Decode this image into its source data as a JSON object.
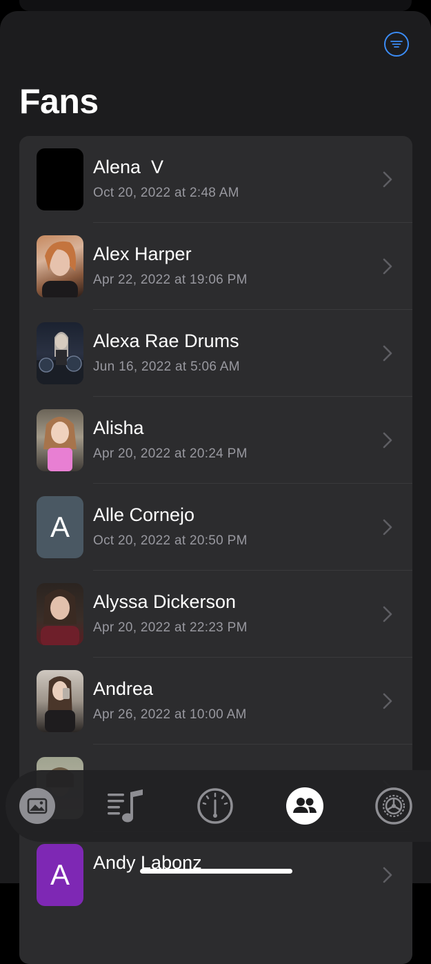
{
  "header": {
    "title": "Fans",
    "filter_icon": "filter-lines-icon"
  },
  "fans": [
    {
      "name": "Alena  V",
      "date": "Oct 20, 2022 at 2:48 AM",
      "avatar": "photo-black"
    },
    {
      "name": "Alex Harper",
      "date": "Apr 22, 2022 at 19:06 PM",
      "avatar": "photo-portrait"
    },
    {
      "name": "Alexa Rae Drums",
      "date": "Jun 16, 2022 at 5:06 AM",
      "avatar": "photo-drummer"
    },
    {
      "name": "Alisha",
      "date": "Apr 20, 2022 at 20:24 PM",
      "avatar": "photo-portrait"
    },
    {
      "name": "Alle Cornejo",
      "date": "Oct 20, 2022 at 20:50 PM",
      "avatar_initial": "A",
      "avatar_color": "#4a5863"
    },
    {
      "name": "Alyssa Dickerson",
      "date": "Apr 20, 2022 at 22:23 PM",
      "avatar": "photo-portrait"
    },
    {
      "name": "Andrea",
      "date": "Apr 26, 2022 at 10:00 AM",
      "avatar": "photo-selfie"
    },
    {
      "name": "",
      "date": "",
      "avatar": "photo-portrait"
    },
    {
      "name": "Andy Labonz",
      "date": "",
      "avatar_initial": "A",
      "avatar_color": "#7e28b4"
    }
  ],
  "tabbar": {
    "items": [
      {
        "icon": "photo-icon",
        "active": false
      },
      {
        "icon": "music-list-icon",
        "active": false
      },
      {
        "icon": "gauge-icon",
        "active": false
      },
      {
        "icon": "people-icon",
        "active": true
      },
      {
        "icon": "settings-icon",
        "active": false
      }
    ]
  },
  "colors": {
    "accent": "#3b8cf6",
    "background": "#1c1c1e",
    "row": "#2c2c2e",
    "secondary_text": "#98989f"
  }
}
